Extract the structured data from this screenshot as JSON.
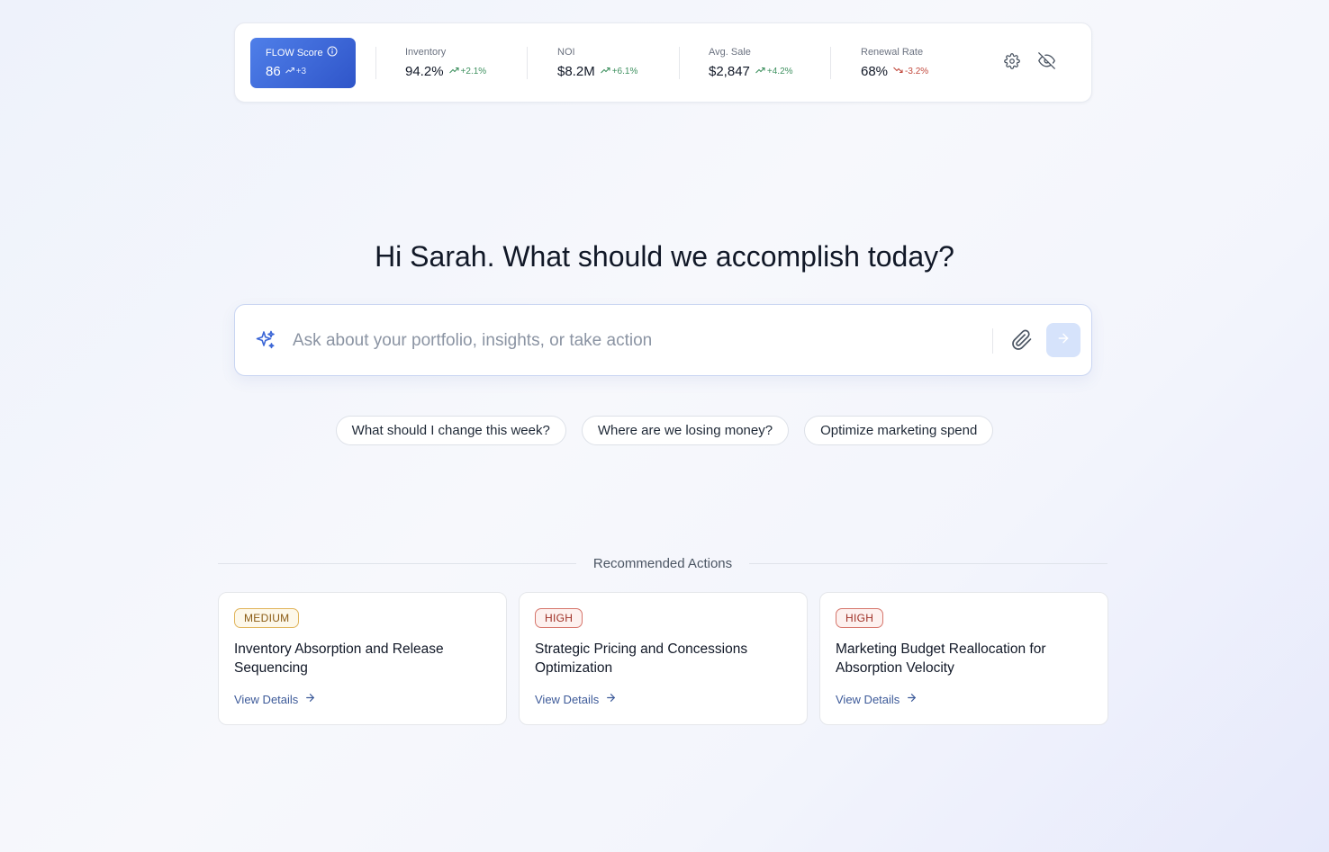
{
  "kpis": {
    "flow": {
      "label": "FLOW Score",
      "value": "86",
      "delta": "+3"
    },
    "items": [
      {
        "label": "Inventory",
        "value": "94.2%",
        "delta": "+2.1%",
        "trend": "up"
      },
      {
        "label": "NOI",
        "value": "$8.2M",
        "delta": "+6.1%",
        "trend": "up"
      },
      {
        "label": "Avg. Sale",
        "value": "$2,847",
        "delta": "+4.2%",
        "trend": "up"
      },
      {
        "label": "Renewal Rate",
        "value": "68%",
        "delta": "-3.2%",
        "trend": "down"
      }
    ]
  },
  "greeting": "Hi Sarah. What should we accomplish today?",
  "search": {
    "placeholder": "Ask about your portfolio, insights, or take action",
    "value": ""
  },
  "suggestions": [
    "What should I change this week?",
    "Where are we losing money?",
    "Optimize marketing spend"
  ],
  "recommended": {
    "title": "Recommended Actions",
    "cards": [
      {
        "priority": "MEDIUM",
        "title": "Inventory Absorption and Release Sequencing",
        "link": "View Details"
      },
      {
        "priority": "HIGH",
        "title": "Strategic Pricing and Concessions Optimization",
        "link": "View Details"
      },
      {
        "priority": "HIGH",
        "title": "Marketing Budget Reallocation for Absorption Velocity",
        "link": "View Details"
      }
    ]
  },
  "colors": {
    "accent": "#3b66d6",
    "positive": "#3f9160",
    "negative": "#c24a3e",
    "medium": "#e0b45a",
    "high": "#d6756b"
  }
}
